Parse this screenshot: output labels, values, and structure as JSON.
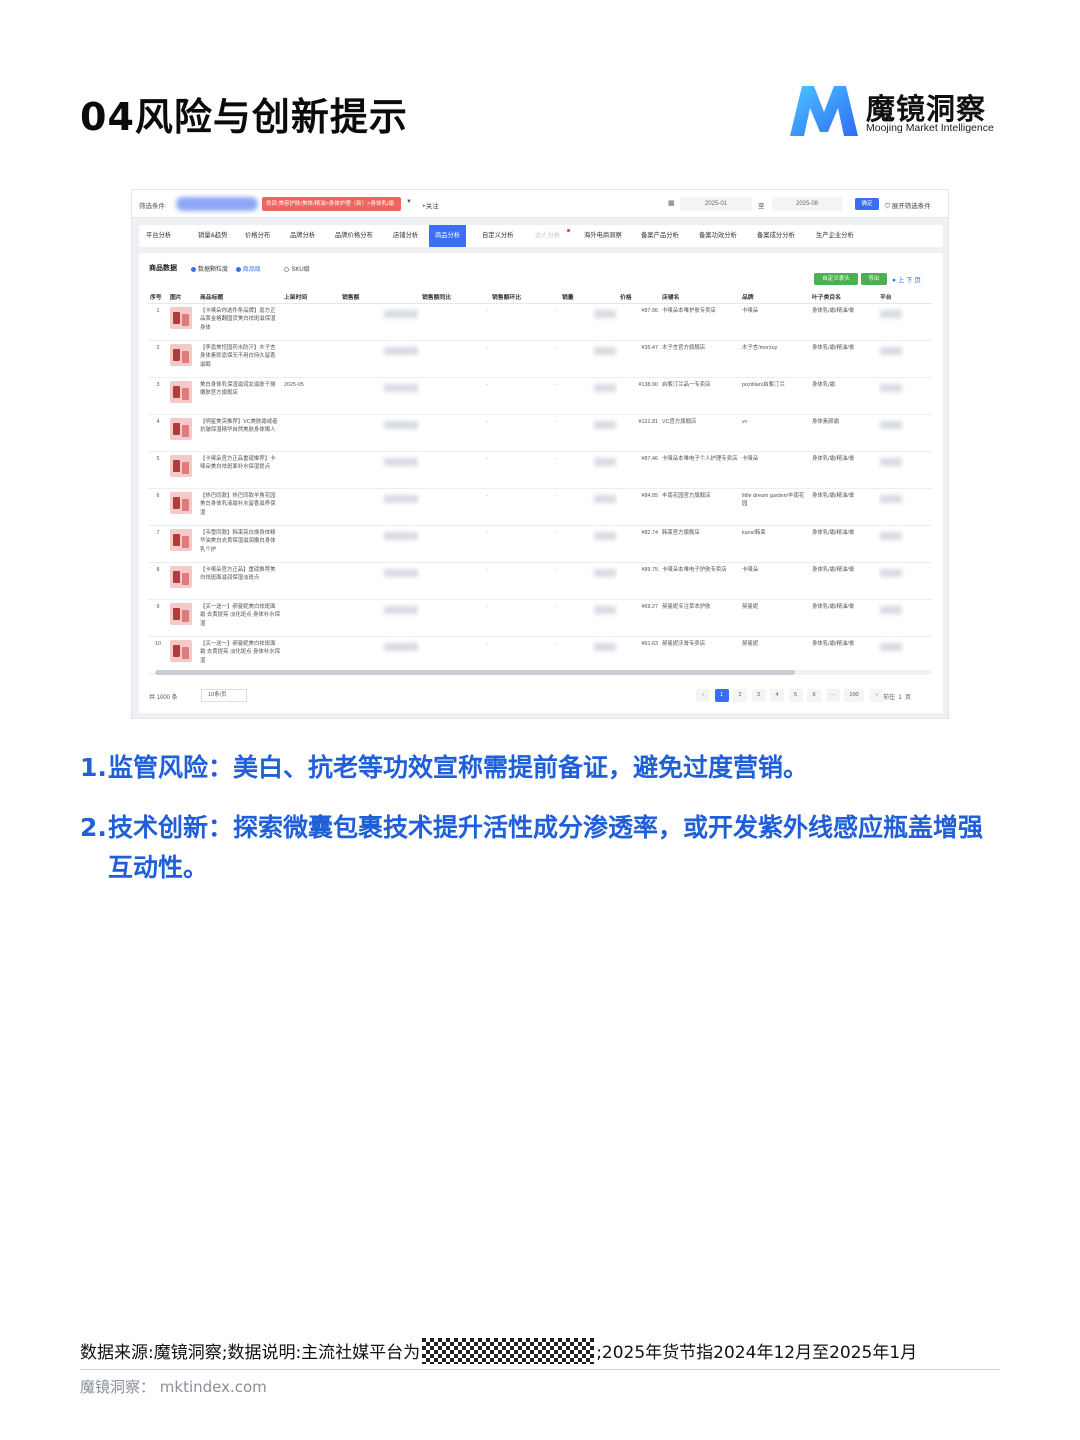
{
  "page": {
    "title": "04风险与创新提示"
  },
  "logo": {
    "name": "魔镜洞察",
    "sub": "Moojing Market Intelligence",
    "colors": [
      "#2f6cf6",
      "#4cc3ff"
    ]
  },
  "screenshot": {
    "filter_label": "筛选条件:",
    "filter_tag": "类目:美容护肤/美体/精油>身体护理（新）>身体乳/霜",
    "follow": "+关注",
    "date_start": "2025-01",
    "date_to": "至",
    "date_end": "2025-08",
    "confirm": "确定",
    "expand": "展开筛选条件",
    "tabs": [
      "平台分析",
      "销量&趋势",
      "价格分布",
      "品牌分析",
      "品牌价格分布",
      "店铺分析",
      "商品分析",
      "自定义分析",
      "达人分析",
      "海外电商洞察",
      "备案产品分析",
      "备案功效分析",
      "备案成分分析",
      "生产企业分析"
    ],
    "active_tab": "商品分析",
    "panel_title": "商品数据",
    "radio_label": "数据颗粒度",
    "radio_on": "商品级",
    "radio_off": "SKU级",
    "btn_custom": "自定义表头",
    "btn_export": "导出",
    "tools": "上 下 页",
    "columns": [
      "序号",
      "图片",
      "商品标题",
      "上架时间",
      "销售额",
      "销售额同比",
      "销售额环比",
      "销量",
      "价格",
      "店铺名",
      "品牌",
      "叶子类目名",
      "平台"
    ],
    "rows": [
      {
        "idx": "1",
        "title": "【卡唛朵你选件条品牌】嘉方正品黄金格翻国货美白祛斑滋保湿身体",
        "date": "",
        "price": "¥87.96",
        "shop": "卡唛朵本唯护肤专卖店",
        "brand": "卡唛朵",
        "cat": "身体乳/霜/精油/膏"
      },
      {
        "idx": "2",
        "title": "【李嘉美挖国药水防汗】木子言身体素即嘉保无不用白持久留香滋眠",
        "date": "",
        "price": "¥35.47",
        "shop": "木子言官方旗舰店",
        "brand": "木子言/morzuy",
        "cat": "身体乳/霜/精油/膏"
      },
      {
        "idx": "3",
        "title": "美白身体乳保湿滋润女滋肤干燥嫩肤官方旗舰店",
        "date": "2025-05",
        "price": "¥138.90",
        "shop": "启紫汀兰品一专卖店",
        "brand": "pozitilan/启紫汀兰",
        "cat": "身体乳/霜"
      },
      {
        "idx": "4",
        "title": "【明星美突推荐】VC美肤霜或者抗皱保湿精华自然美肤身体懒人",
        "date": "",
        "price": "¥122.81",
        "shop": "VC官方旗舰店",
        "brand": "vc",
        "cat": "身体素颜霜"
      },
      {
        "idx": "5",
        "title": "【卡唛朵官方正品重磅推荐】卡唛朵美白祛斑面补水保湿提点",
        "date": "",
        "price": "¥87.46",
        "shop": "卡唛朵本唯电子个人护理专卖店",
        "brand": "卡唛朵",
        "cat": "身体乳/霜/精油/膏"
      },
      {
        "idx": "6",
        "title": "【热巴同款】热巴同款羊角花园美白身体乳液霜补水留香滋养保湿",
        "date": "",
        "price": "¥84.85",
        "shop": "丰南花园官方旗舰店",
        "brand": "little dream garden/丰南花园",
        "cat": "身体乳/霜/精油/膏"
      },
      {
        "idx": "7",
        "title": "【韦雪同款】韩束亮白焕身体精华油美白去黄保湿滋润嫩白身体乳个护",
        "date": "",
        "price": "¥82.74",
        "shop": "韩束官方旗舰店",
        "brand": "kans/韩束",
        "cat": "身体乳/霜/精油/膏"
      },
      {
        "idx": "8",
        "title": "【卡唛朵官方正品】重磅推荐美白祛斑面滋润保湿淡斑点",
        "date": "",
        "price": "¥89.75",
        "shop": "卡唛朵本唯电子护肤专卖店",
        "brand": "卡唛朵",
        "cat": "身体乳/霜/精油/膏"
      },
      {
        "idx": "9",
        "title": "【买一送一】郝曼妮美白祛斑面霜 去黄提亮 淡化斑点 身体补水保湿",
        "date": "",
        "price": "¥69.27",
        "shop": "郝曼妮专注草本护肤",
        "brand": "郝曼妮",
        "cat": "身体乳/霜/精油/膏"
      },
      {
        "idx": "10",
        "title": "【买一送一】郝曼妮美白祛斑面霜 去黄提亮 淡化斑点 身体补水保湿",
        "date": "",
        "price": "¥61.63",
        "shop": "郝曼妮沃膏专卖店",
        "brand": "郝曼妮",
        "cat": "身体乳/霜/精油/膏"
      }
    ],
    "pager": {
      "total": "共 1000 条",
      "size": "10条/页",
      "prev": "‹",
      "pages": [
        "1",
        "2",
        "3",
        "4",
        "5",
        "6",
        "···",
        "100"
      ],
      "next": "›",
      "goto_label": "前往",
      "goto_value": "1",
      "goto_unit": "页"
    }
  },
  "points": [
    {
      "num": "1.",
      "text": "监管风险：美白、抗老等功效宣称需提前备证，避免过度营销。"
    },
    {
      "num": "2.",
      "text": "技术创新：探索微囊包裹技术提升活性成分渗透率，或开发紫外线感应瓶盖增强互动性。"
    }
  ],
  "footer": {
    "source_prefix": "数据来源:魔镜洞察;数据说明:主流社媒平台为",
    "source_suffix": ";2025年货节指2024年12月至2025年1月",
    "site": "魔镜洞察：  mktindex.com"
  }
}
